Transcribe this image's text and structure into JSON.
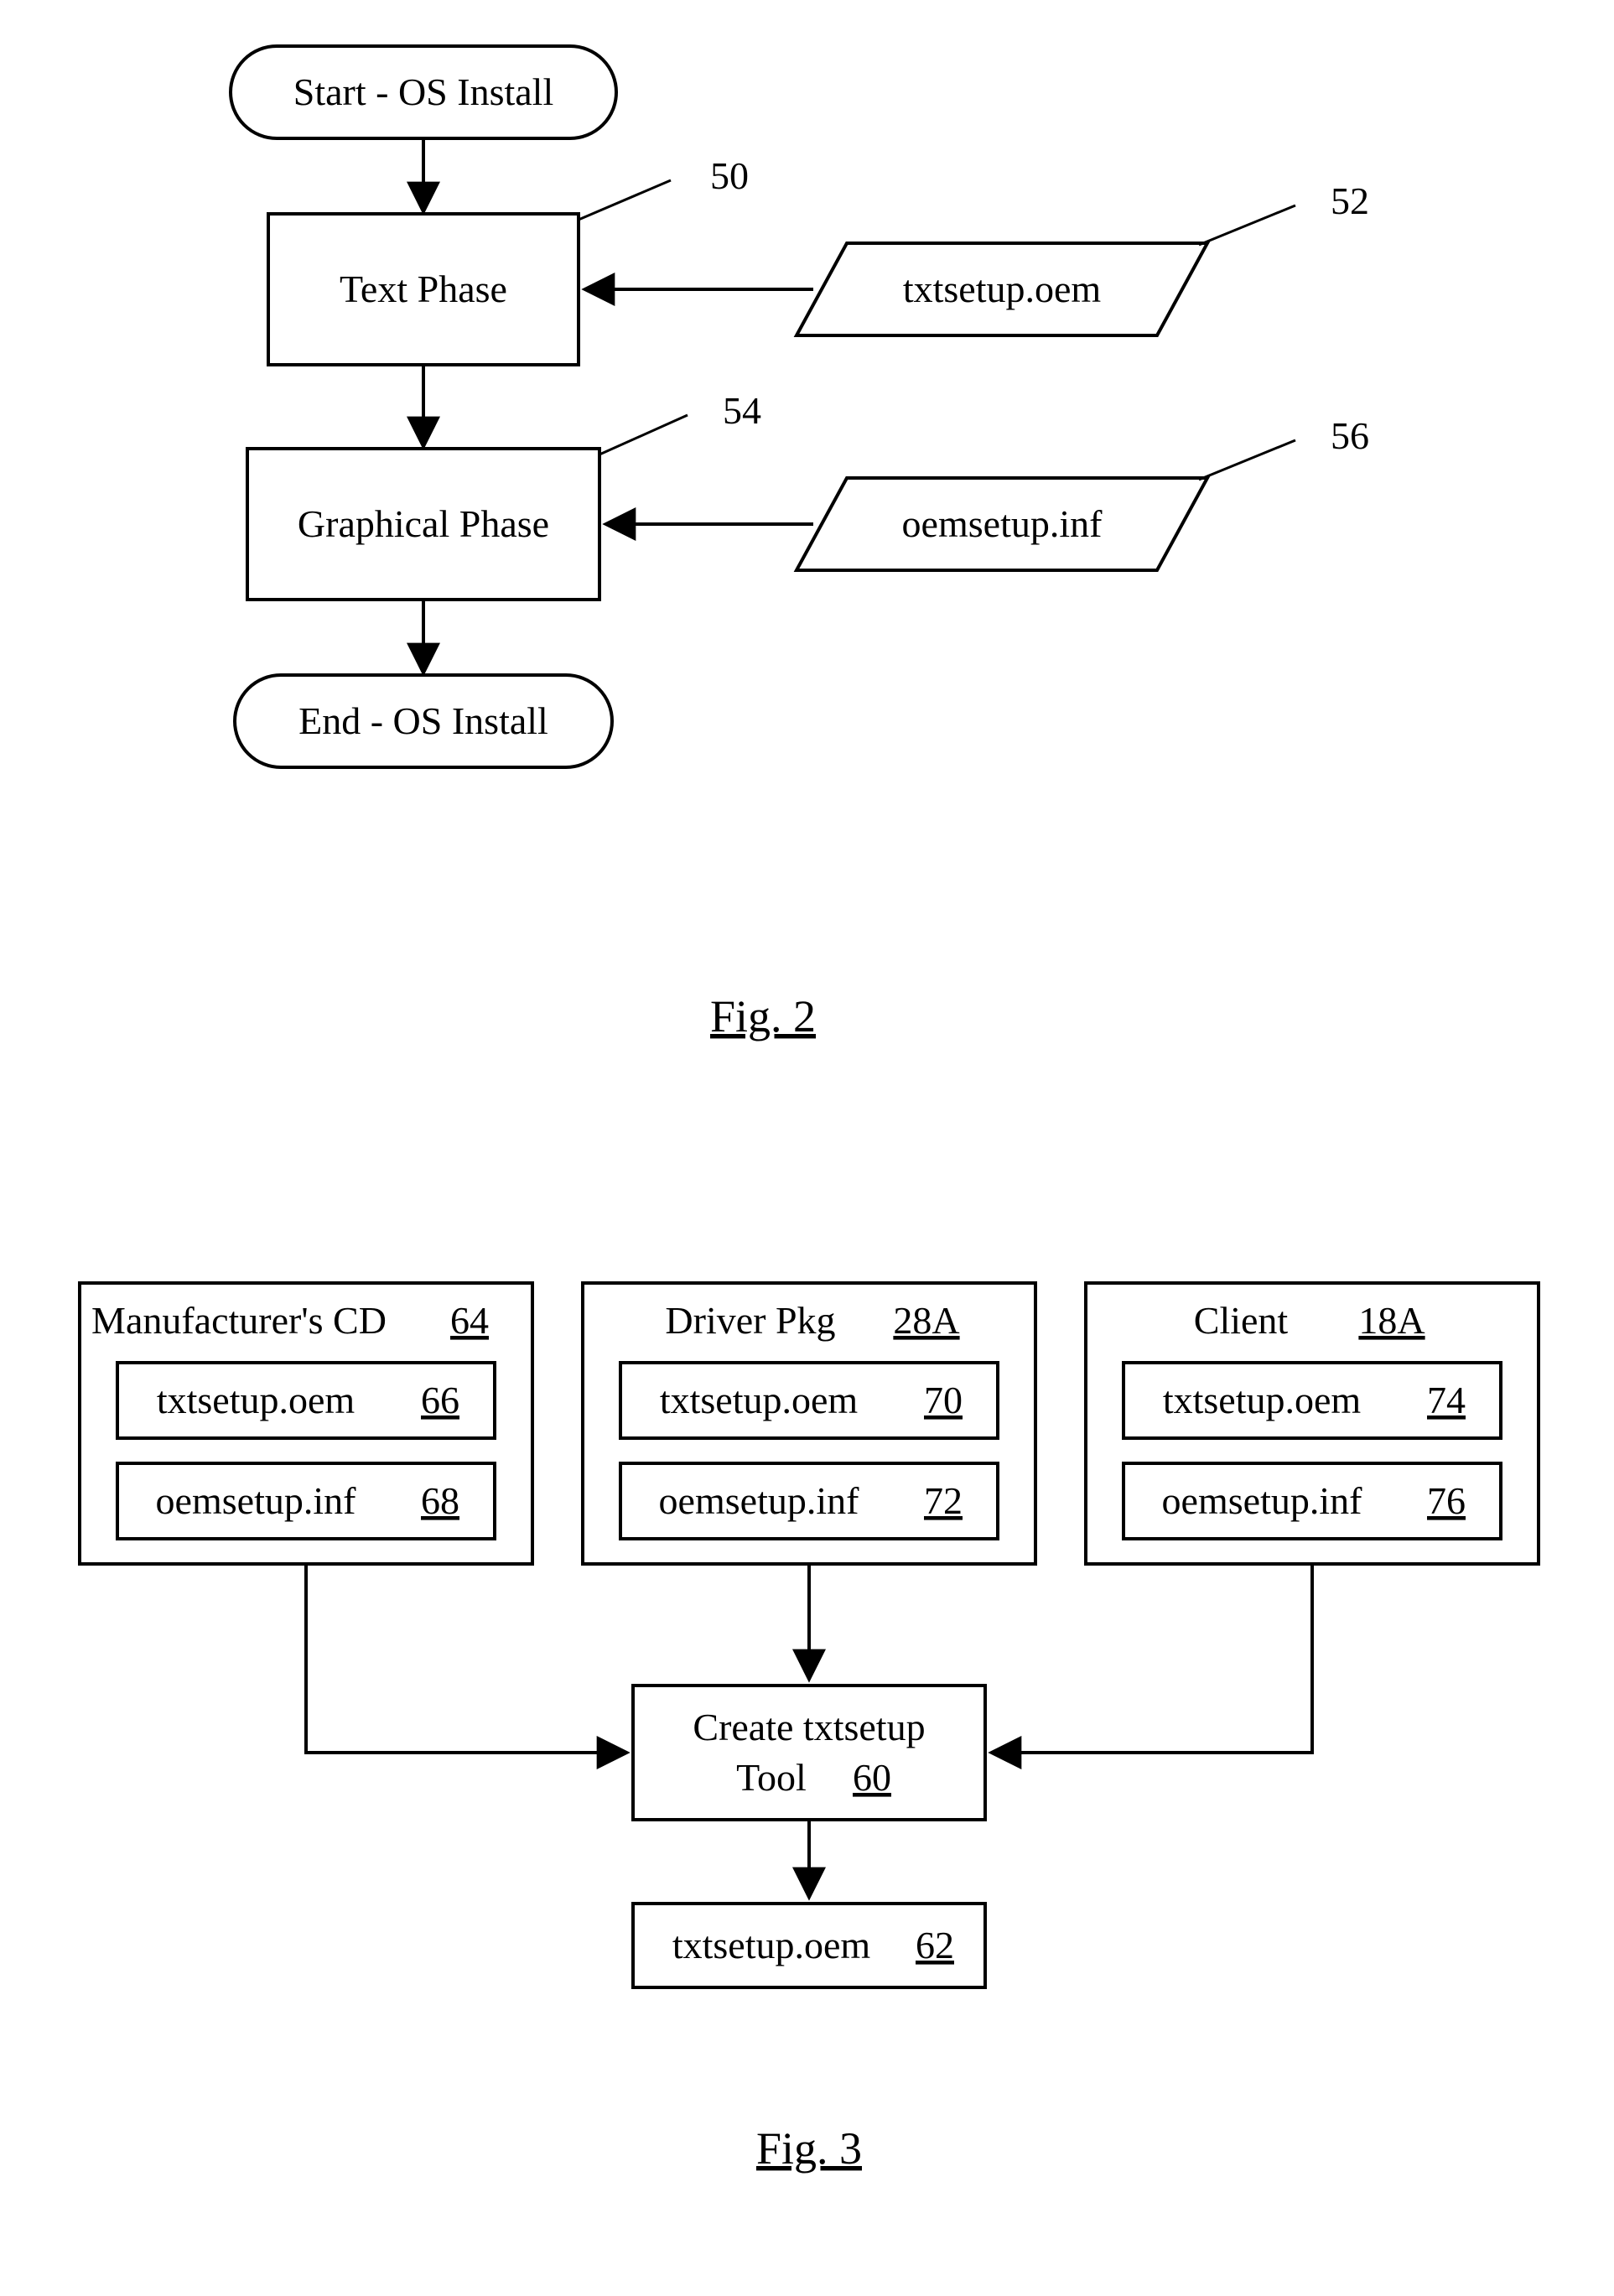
{
  "fig2": {
    "caption": "Fig. 2",
    "start": "Start - OS Install",
    "end": "End - OS Install",
    "textPhase": {
      "label": "Text Phase",
      "ref": "50"
    },
    "graphPhase": {
      "label": "Graphical Phase",
      "ref": "54"
    },
    "txtInput": {
      "label": "txtsetup.oem",
      "ref": "52"
    },
    "oemInput": {
      "label": "oemsetup.inf",
      "ref": "56"
    }
  },
  "fig3": {
    "caption": "Fig. 3",
    "box1": {
      "title": "Manufacturer's CD",
      "ref": "64",
      "item1": "txtsetup.oem",
      "ref1": "66",
      "item2": "oemsetup.inf",
      "ref2": "68"
    },
    "box2": {
      "title": "Driver Pkg",
      "ref": "28A",
      "item1": "txtsetup.oem",
      "ref1": "70",
      "item2": "oemsetup.inf",
      "ref2": "72"
    },
    "box3": {
      "title": "Client",
      "ref": "18A",
      "item1": "txtsetup.oem",
      "ref1": "74",
      "item2": "oemsetup.inf",
      "ref2": "76"
    },
    "tool": {
      "line1": "Create txtsetup",
      "line2": "Tool",
      "ref": "60"
    },
    "out": {
      "label": "txtsetup.oem",
      "ref": "62"
    }
  }
}
